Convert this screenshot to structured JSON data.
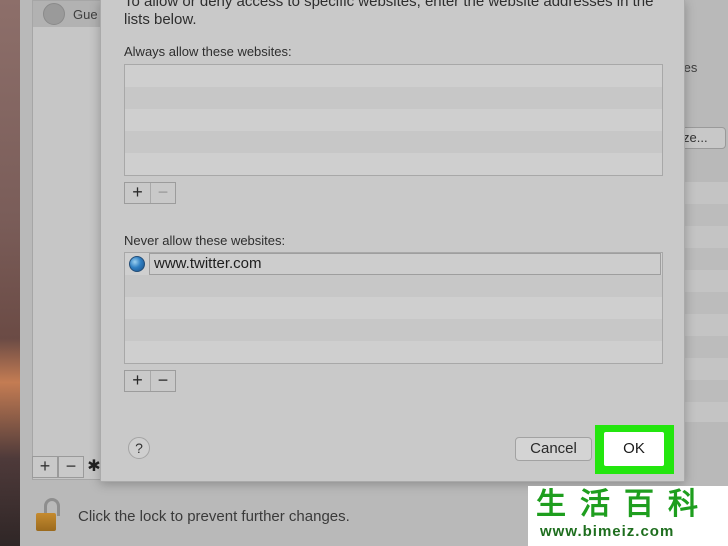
{
  "background_window": {
    "user_name": "Gue",
    "userlist_add": "+",
    "userlist_remove": "−",
    "userlist_gear": "✱",
    "right_text": "tes",
    "right_button": "ze...",
    "lock_text": "Click the lock to prevent further changes."
  },
  "sheet": {
    "intro": "To allow or deny access to specific websites, enter the website addresses in the lists below.",
    "allow_label": "Always allow these websites:",
    "allow_entries": [],
    "allow_add": "+",
    "allow_remove": "−",
    "deny_label": "Never allow these websites:",
    "deny_entries": [
      "www.twitter.com"
    ],
    "deny_add": "+",
    "deny_remove": "−",
    "help": "?",
    "cancel": "Cancel",
    "ok": "OK"
  },
  "highlight_color": "#23e60e",
  "watermark": {
    "chars": "生活百科",
    "url": "www.bimeiz.com"
  }
}
